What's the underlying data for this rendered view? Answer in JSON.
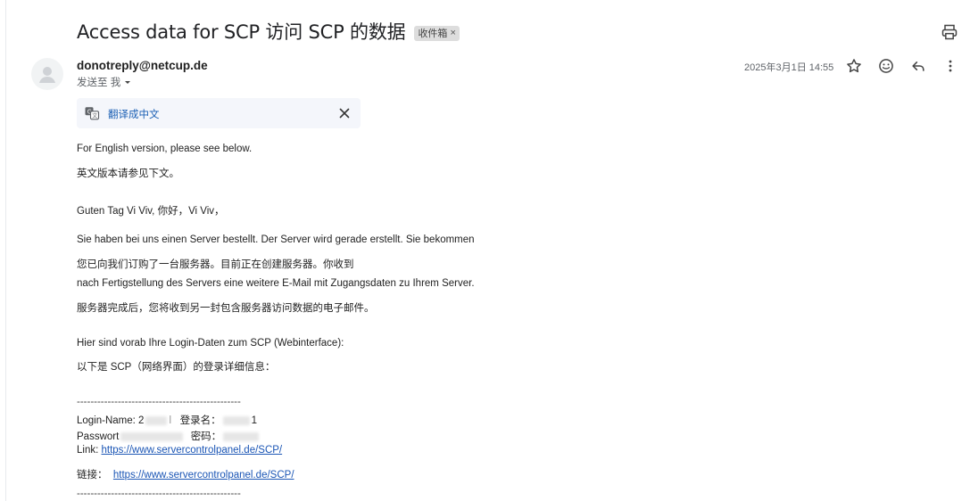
{
  "subject": {
    "title": "Access data for SCP  访问 SCP 的数据",
    "label": "收件箱",
    "label_close": "×"
  },
  "sender": {
    "name": "donotreply@netcup.de",
    "to": "发送至 我",
    "date": "2025年3月1日 14:55"
  },
  "translate": {
    "link": "翻译成中文"
  },
  "body": {
    "line1": "For English version, please see below.",
    "line2": "英文版本请参见下文。",
    "line3": "Guten Tag Vi Viv,  你好，Vi Viv，",
    "line4": "Sie haben bei uns einen Server bestellt. Der Server wird gerade erstellt. Sie bekommen",
    "line5": "您已向我们订购了一台服务器。目前正在创建服务器。你收到",
    "line6": "nach Fertigstellung des Servers eine weitere E-Mail mit Zugangsdaten zu Ihrem Server.",
    "line7": "服务器完成后，您将收到另一封包含服务器访问数据的电子邮件。",
    "line8": "Hier sind vorab Ihre Login-Daten zum SCP (Webinterface):",
    "line9": "以下是 SCP（网络界面）的登录详细信息：",
    "separator": "------------------------------------------------",
    "login_label": "Login-Name: 2",
    "login_cn_label": "登录名：",
    "login_tail": "1",
    "pass_label": "Passwort",
    "pass_cn_label": "密码：",
    "link_label": "Link: ",
    "link_url": "https://www.servercontrolpanel.de/SCP/",
    "link_cn_label": "链接：",
    "link_cn_url": "https://www.servercontrolpanel.de/SCP/"
  }
}
